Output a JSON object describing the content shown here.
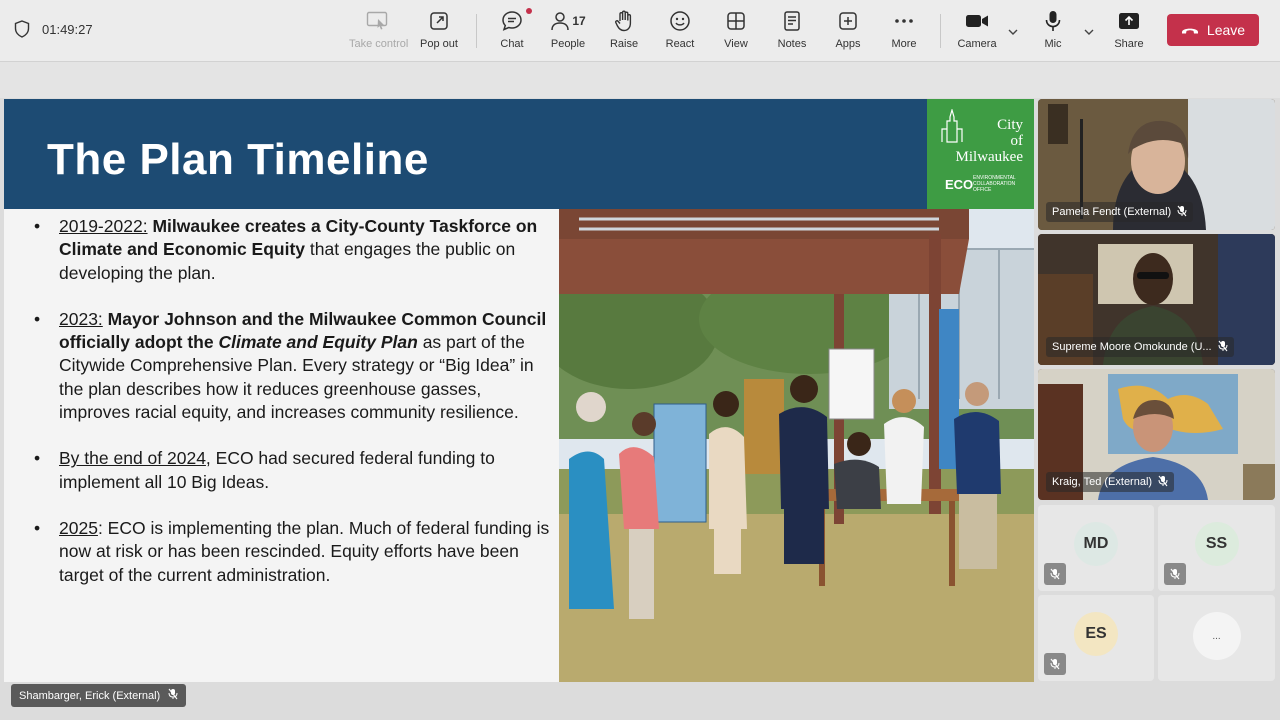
{
  "meeting": {
    "timer": "01:49:27",
    "shield_icon": "shield-icon"
  },
  "toolbar": {
    "take_control": "Take control",
    "pop_out": "Pop out",
    "chat": "Chat",
    "people": "People",
    "people_count": "17",
    "raise": "Raise",
    "react": "React",
    "view": "View",
    "notes": "Notes",
    "apps": "Apps",
    "more": "More",
    "camera": "Camera",
    "mic": "Mic",
    "share": "Share",
    "leave": "Leave",
    "leave_color": "#c4314b"
  },
  "slide": {
    "title": "The Plan Timeline",
    "header_color": "#1d4b73",
    "logo": {
      "city_line1": "City",
      "city_line2": "of",
      "city_line3": "Milwaukee",
      "eco": "ECO",
      "sub": "ENVIRONMENTAL COLLABORATION OFFICE",
      "bg_color": "#3e9c44"
    },
    "bullets": [
      {
        "date": "2019-2022:",
        "bold": "Milwaukee creates a City-County Taskforce on Climate and Economic Equity",
        "rest": " that engages the public on developing the plan."
      },
      {
        "date": "2023:",
        "bold": "Mayor Johnson and the Milwaukee Common Council officially adopt the ",
        "italic": "Climate and Equity Plan",
        "rest": " as part of the Citywide Comprehensive Plan. Every strategy or “Big Idea” in the plan describes how it reduces greenhouse gasses, improves racial equity, and increases community resilience."
      },
      {
        "date": "By the end of 2024",
        "rest": ", ECO had secured federal funding to implement all 10 Big Ideas."
      },
      {
        "date": "2025",
        "rest": ":  ECO is implementing the plan. Much of federal funding is now at risk or has been rescinded. Equity efforts have been target of the current administration."
      }
    ]
  },
  "participants": [
    {
      "name": "Pamela Fendt (External)",
      "muted": true
    },
    {
      "name": "Supreme Moore Omokunde (U...",
      "muted": true
    },
    {
      "name": "Kraig, Ted (External)",
      "muted": true
    }
  ],
  "avatars": [
    {
      "initials": "MD",
      "color": "#dde8e4"
    },
    {
      "initials": "SS",
      "color": "#dcebdd"
    },
    {
      "initials": "ES",
      "color": "#f3e6c2"
    }
  ],
  "overflow_label": "...",
  "presenter": {
    "name": "Shambarger, Erick (External)"
  }
}
